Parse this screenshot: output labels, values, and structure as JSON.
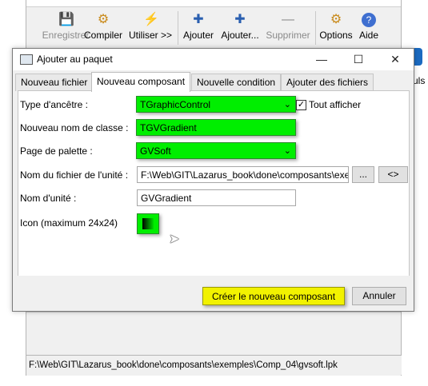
{
  "toolbar": {
    "save": "Enregistrer",
    "compile": "Compiler",
    "use": "Utiliser >>",
    "add": "Ajouter",
    "add_more": "Ajouter...",
    "remove": "Supprimer",
    "options": "Options",
    "help": "Aide"
  },
  "right_partial_text": "uls",
  "status_bar": "F:\\Web\\GIT\\Lazarus_book\\done\\composants\\exemples\\Comp_04\\gvsoft.lpk",
  "dialog": {
    "title": "Ajouter au paquet",
    "tabs": [
      "Nouveau fichier",
      "Nouveau composant",
      "Nouvelle condition",
      "Ajouter des fichiers"
    ],
    "ancestor_label": "Type d'ancêtre :",
    "ancestor_value": "TGraphicControl",
    "show_all_label": "Tout afficher",
    "show_all_checked": true,
    "classname_label": "Nouveau nom de classe :",
    "classname_value": "TGVGradient",
    "palette_label": "Page de palette :",
    "palette_value": "GVSoft",
    "unitfile_label": "Nom du fichier de l'unité :",
    "unitfile_value": "F:\\Web\\GIT\\Lazarus_book\\done\\composants\\exe",
    "browse_label": "...",
    "shorten_label": "<>",
    "unitname_label": "Nom d'unité :",
    "unitname_value": "GVGradient",
    "icon_label": "Icon (maximum 24x24)",
    "create_button": "Créer le nouveau composant",
    "cancel_button": "Annuler"
  },
  "colors": {
    "highlight_green": "#00ee00",
    "highlight_yellow": "#f2f200"
  }
}
